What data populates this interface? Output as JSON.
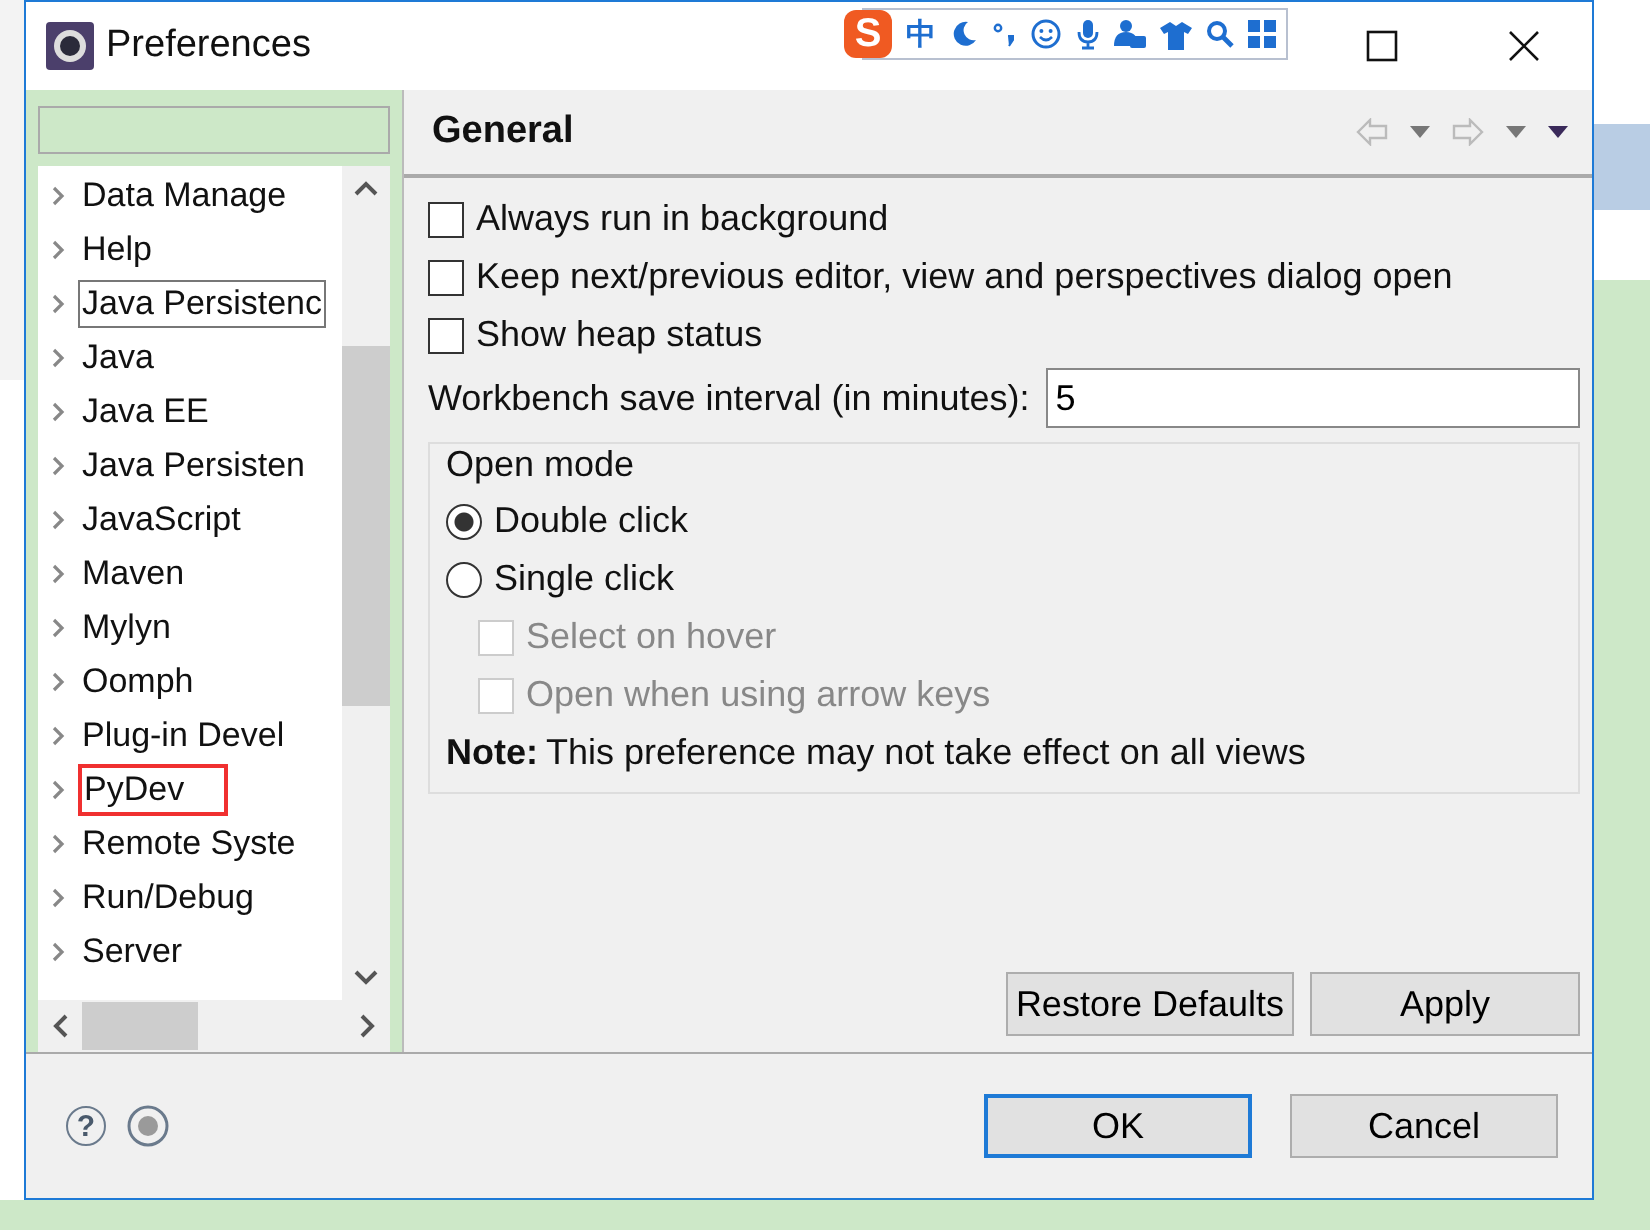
{
  "window": {
    "title": "Preferences"
  },
  "ime_bar": {
    "logo": "S",
    "mode": "中"
  },
  "tree": {
    "items": [
      {
        "label": "Data Manage",
        "focused": false,
        "annotated": false
      },
      {
        "label": "Help",
        "focused": false,
        "annotated": false
      },
      {
        "label": "Java Persistenc",
        "focused": true,
        "annotated": false
      },
      {
        "label": "Java",
        "focused": false,
        "annotated": false
      },
      {
        "label": "Java EE",
        "focused": false,
        "annotated": false
      },
      {
        "label": "Java Persisten",
        "focused": false,
        "annotated": false
      },
      {
        "label": "JavaScript",
        "focused": false,
        "annotated": false
      },
      {
        "label": "Maven",
        "focused": false,
        "annotated": false
      },
      {
        "label": "Mylyn",
        "focused": false,
        "annotated": false
      },
      {
        "label": "Oomph",
        "focused": false,
        "annotated": false
      },
      {
        "label": "Plug-in Devel",
        "focused": false,
        "annotated": false
      },
      {
        "label": "PyDev",
        "focused": false,
        "annotated": true
      },
      {
        "label": "Remote Syste",
        "focused": false,
        "annotated": false
      },
      {
        "label": "Run/Debug",
        "focused": false,
        "annotated": false
      },
      {
        "label": "Server",
        "focused": false,
        "annotated": false
      }
    ]
  },
  "page": {
    "title": "General",
    "options": [
      {
        "label": "Always run in background",
        "checked": false
      },
      {
        "label": "Keep next/previous editor, view and perspectives dialog open",
        "checked": false
      },
      {
        "label": "Show heap status",
        "checked": false
      }
    ],
    "save_interval": {
      "label": "Workbench save interval (in minutes):",
      "value": "5"
    },
    "open_mode": {
      "title": "Open mode",
      "radios": [
        {
          "label": "Double click",
          "selected": true
        },
        {
          "label": "Single click",
          "selected": false
        }
      ],
      "sub_options": [
        {
          "label": "Select on hover",
          "checked": false,
          "disabled": true
        },
        {
          "label": "Open when using arrow keys",
          "checked": false,
          "disabled": true
        }
      ],
      "note": "**Note:** This preference may not take effect on all views"
    },
    "buttons": [
      "Restore Defaults",
      "Apply"
    ]
  },
  "footer": {
    "help": "?",
    "buttons": [
      {
        "label": "OK",
        "default": true
      },
      {
        "label": "Cancel",
        "default": false
      }
    ]
  }
}
